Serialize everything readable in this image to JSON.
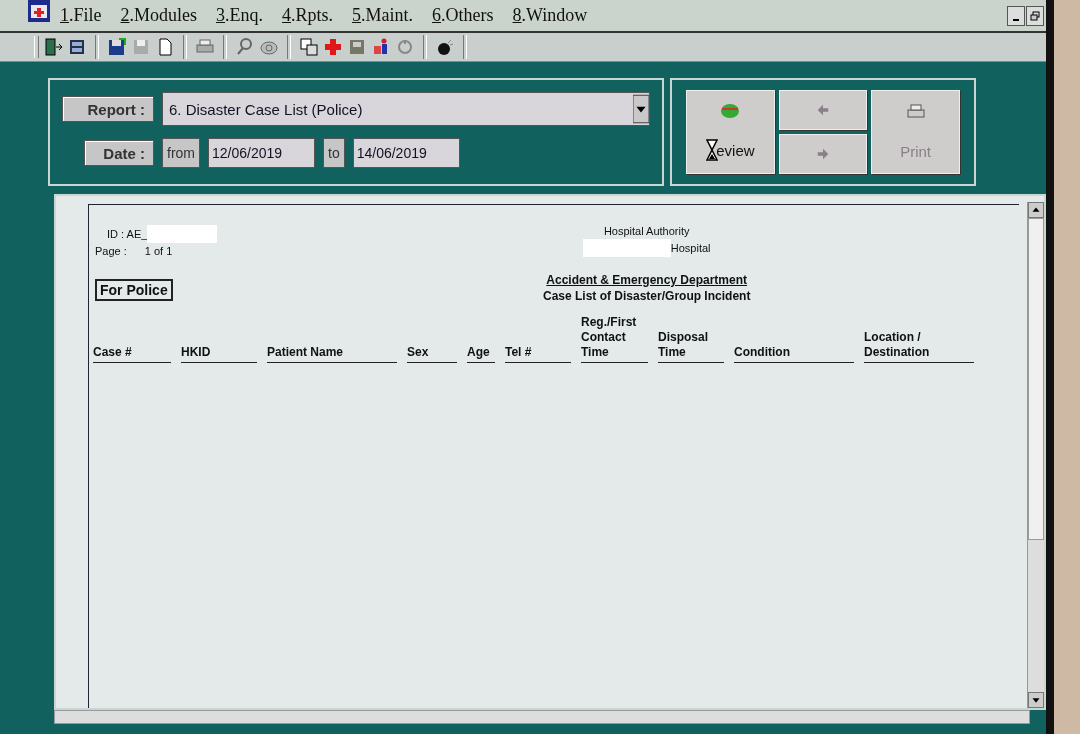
{
  "menu": [
    {
      "label": "1.File"
    },
    {
      "label": "2.Modules"
    },
    {
      "label": "3.Enq."
    },
    {
      "label": "4.Rpts."
    },
    {
      "label": "5.Maint."
    },
    {
      "label": "6.Others"
    },
    {
      "label": "8.Window"
    }
  ],
  "criteria": {
    "report_label": "Report :",
    "report_value": "6. Disaster Case List (Police)",
    "date_label": "Date :",
    "from_label": "from",
    "from_value": "12/06/2019",
    "to_label": "to",
    "to_value": "14/06/2019"
  },
  "actions": [
    {
      "kind": "preview",
      "label": "eview",
      "disabled": false
    },
    {
      "kind": "prev",
      "disabled": true
    },
    {
      "kind": "next",
      "disabled": true
    },
    {
      "kind": "print",
      "label": "Print",
      "disabled": true
    }
  ],
  "report": {
    "id_label": "ID : AE_",
    "page_label": "Page :",
    "page_value": "1 of 1",
    "authority": "Hospital Authority",
    "hospital": "Hospital",
    "badge": "For Police",
    "department": "Accident & Emergency Department",
    "subtitle": "Case List of Disaster/Group Incident",
    "columns": [
      "Case #",
      "HKID",
      "Patient Name",
      "Sex",
      "Age",
      "Tel #",
      "Reg./First\nContact\nTime",
      "Disposal\nTime",
      "Condition",
      "Location /\nDestination"
    ]
  }
}
